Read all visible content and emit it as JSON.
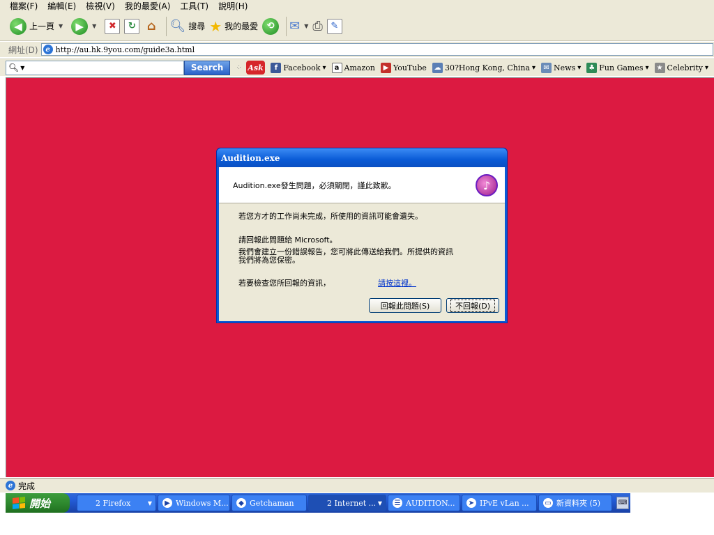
{
  "menu": [
    "檔案(F)",
    "編輯(E)",
    "檢視(V)",
    "我的最愛(A)",
    "工具(T)",
    "說明(H)"
  ],
  "toolbar": {
    "back_label": "上一頁",
    "search_label": "搜尋",
    "favorites_label": "我的最愛"
  },
  "address": {
    "label": "網址(D)",
    "url": "http://au.hk.9you.com/guide3a.html"
  },
  "ask": {
    "search_button": "Search",
    "logo": "Ask",
    "links": [
      {
        "label": "Facebook",
        "icon": "f",
        "color": "#3b5998",
        "dropdown": true
      },
      {
        "label": "Amazon",
        "icon": "a",
        "color": "#ffffff",
        "dropdown": false
      },
      {
        "label": "YouTube",
        "icon": "▶",
        "color": "#c4302b",
        "dropdown": false
      },
      {
        "label": "30?Hong Kong, China",
        "icon": "☁",
        "color": "#5b7fb5",
        "dropdown": true
      },
      {
        "label": "News",
        "icon": "✉",
        "color": "#6b8cb8",
        "dropdown": true
      },
      {
        "label": "Fun Games",
        "icon": "♣",
        "color": "#2e8b57",
        "dropdown": true
      },
      {
        "label": "Celebrity",
        "icon": "★",
        "color": "#8a8a8a",
        "dropdown": true
      }
    ]
  },
  "colors": {
    "content_bg": "#dc1a41",
    "dialog_frame": "#0a5bd6",
    "taskbar": "#245edb",
    "start": "#2f8a2f"
  },
  "dialog": {
    "title": "Audition.exe",
    "header_text": "Audition.exe發生問題，必須關閉，謹此致歉。",
    "line1": "若您方才的工作尚未完成，所使用的資訊可能會遺失。",
    "line2": "請回報此問題給 Microsoft。",
    "line3": "我們會建立一份錯誤報告，您可將此傳送給我們。所提供的資訊",
    "line4": "我們將為您保密。",
    "line5": "若要檢查您所回報的資訊，",
    "link": "請按這裡。",
    "send_button": "回報此問題(S)",
    "dont_send_button": "不回報(D)"
  },
  "status": {
    "text": "完成"
  },
  "taskbar": {
    "start": "開始",
    "tasks": [
      {
        "label": "2 Firefox",
        "icon": "",
        "dropdown": true,
        "active": false,
        "width": 114
      },
      {
        "label": "Windows M...",
        "icon": "▶",
        "dropdown": false,
        "active": false,
        "width": 104
      },
      {
        "label": "Getchaman",
        "icon": "◆",
        "dropdown": false,
        "active": false,
        "width": 108
      },
      {
        "label": "2 Internet ...",
        "icon": "",
        "dropdown": true,
        "active": true,
        "width": 112
      },
      {
        "label": "AUDITION...",
        "icon": "☰",
        "dropdown": false,
        "active": false,
        "width": 104
      },
      {
        "label": "IPvE vLan ...",
        "icon": "➤",
        "dropdown": false,
        "active": false,
        "width": 108
      },
      {
        "label": "新資料夾 (5)",
        "icon": "▭",
        "dropdown": false,
        "active": false,
        "width": 106
      }
    ]
  }
}
